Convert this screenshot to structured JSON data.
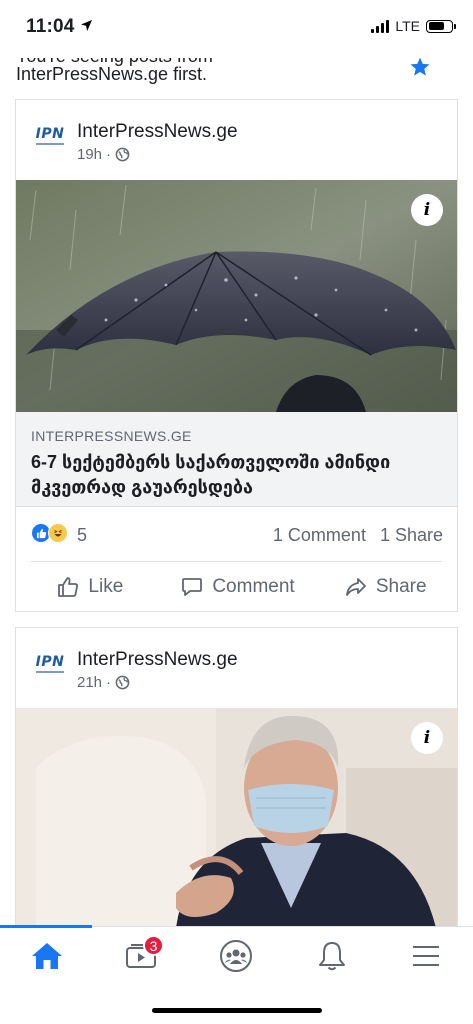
{
  "status_bar": {
    "time": "11:04",
    "network": "LTE"
  },
  "notice": {
    "line1": "You're seeing posts from",
    "page": "InterPressNews.ge",
    "suffix": " first."
  },
  "posts": [
    {
      "page_name": "InterPressNews.ge",
      "logo_text": "IPN",
      "time": "19h",
      "separator": "·",
      "link_domain": "INTERPRESSNEWS.GE",
      "link_title": "6-7 სექტემბერს საქართველოში ამინდი მკვეთრად გაუარესდება",
      "reaction_count": "5",
      "comments": "1 Comment",
      "shares": "1 Share"
    },
    {
      "page_name": "InterPressNews.ge",
      "logo_text": "IPN",
      "time": "21h",
      "separator": "·"
    }
  ],
  "actions": {
    "like": "Like",
    "comment": "Comment",
    "share": "Share"
  },
  "nav": {
    "video_badge": "3"
  },
  "colors": {
    "accent": "#1877f2",
    "badge": "#e41e3f"
  }
}
